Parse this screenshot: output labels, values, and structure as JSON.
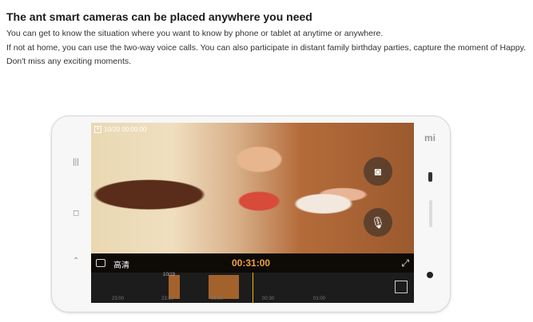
{
  "heading": "The ant smart cameras can be placed anywhere you need",
  "paragraphs": [
    "You can get to know the situation where you want to know by phone or tablet at anytime or anywhere.",
    "If not at home, you can use the two-way voice calls. You can also participate in distant family birthday parties, capture the moment of Happy.",
    "Don't miss any exciting moments."
  ],
  "phone": {
    "brand_logo": "mi",
    "camera_app": {
      "timestamp": "10/20 00:00:00",
      "quality_label": "高清",
      "playback_time": "00:31:00",
      "timeline_date": "10/19",
      "timeline_ticks": [
        "23:00",
        "23:30",
        "00:00",
        "00:30",
        "01:00"
      ]
    }
  }
}
